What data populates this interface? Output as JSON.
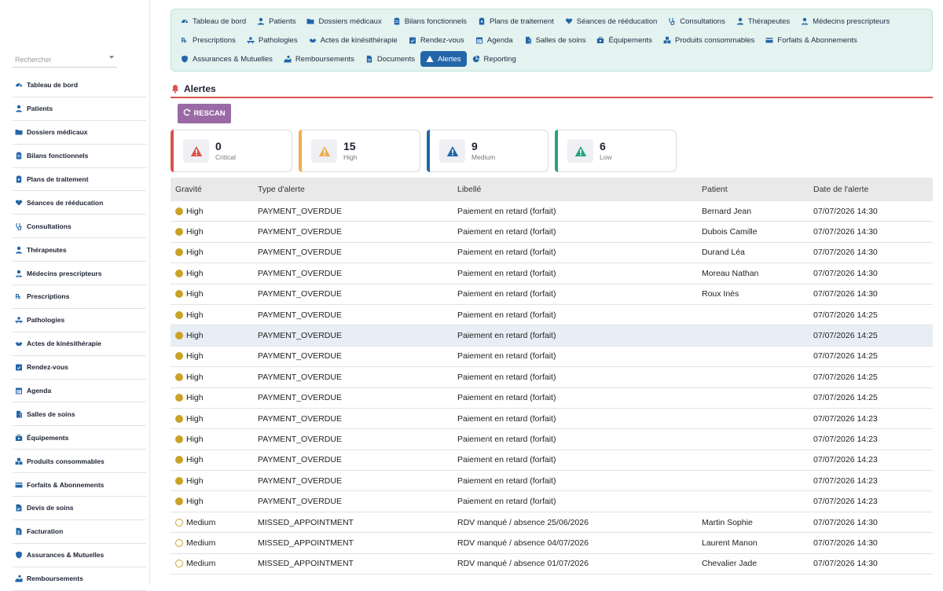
{
  "sidebar": {
    "search_placeholder": "Rechercher",
    "items": [
      {
        "label": "Tableau de bord",
        "icon": "dashboard-icon"
      },
      {
        "label": "Patients",
        "icon": "user-icon"
      },
      {
        "label": "Dossiers médicaux",
        "icon": "folder-icon"
      },
      {
        "label": "Bilans fonctionnels",
        "icon": "clipboard-icon"
      },
      {
        "label": "Plans de traitement",
        "icon": "clipboard-list-icon"
      },
      {
        "label": "Séances de rééducation",
        "icon": "heart-hand-icon"
      },
      {
        "label": "Consultations",
        "icon": "stethoscope-icon"
      },
      {
        "label": "Thérapeutes",
        "icon": "user-md-icon"
      },
      {
        "label": "Médecins prescripteurs",
        "icon": "doctor-icon"
      },
      {
        "label": "Prescriptions",
        "icon": "prescription-icon"
      },
      {
        "label": "Pathologies",
        "icon": "procedure-icon"
      },
      {
        "label": "Actes de kinésithérapie",
        "icon": "hands-icon"
      },
      {
        "label": "Rendez-vous",
        "icon": "calendar-check-icon"
      },
      {
        "label": "Agenda",
        "icon": "calendar-icon"
      },
      {
        "label": "Salles de soins",
        "icon": "door-icon"
      },
      {
        "label": "Équipements",
        "icon": "toolbox-icon"
      },
      {
        "label": "Produits consommables",
        "icon": "boxes-icon"
      },
      {
        "label": "Forfaits & Abonnements",
        "icon": "card-icon"
      },
      {
        "label": "Devis de soins",
        "icon": "file-edit-icon"
      },
      {
        "label": "Facturation",
        "icon": "invoice-icon"
      },
      {
        "label": "Assurances & Mutuelles",
        "icon": "shield-icon"
      },
      {
        "label": "Remboursements",
        "icon": "refund-icon"
      }
    ]
  },
  "topnav": {
    "row1": [
      {
        "label": "Tableau de bord",
        "icon": "dashboard-icon"
      },
      {
        "label": "Patients",
        "icon": "user-icon"
      },
      {
        "label": "Dossiers médicaux",
        "icon": "folder-icon"
      },
      {
        "label": "Bilans fonctionnels",
        "icon": "clipboard-icon"
      },
      {
        "label": "Plans de traitement",
        "icon": "clipboard-list-icon"
      },
      {
        "label": "Séances de rééducation",
        "icon": "heart-hand-icon"
      },
      {
        "label": "Consultations",
        "icon": "stethoscope-icon"
      },
      {
        "label": "Thérapeutes",
        "icon": "user-md-icon"
      },
      {
        "label": "Médecins prescripteurs",
        "icon": "doctor-icon"
      }
    ],
    "row2": [
      {
        "label": "Prescriptions",
        "icon": "prescription-icon"
      },
      {
        "label": "Pathologies",
        "icon": "procedure-icon"
      },
      {
        "label": "Actes de kinésithérapie",
        "icon": "hands-icon"
      },
      {
        "label": "Rendez-vous",
        "icon": "calendar-check-icon"
      },
      {
        "label": "Agenda",
        "icon": "calendar-icon"
      },
      {
        "label": "Salles de soins",
        "icon": "door-icon"
      },
      {
        "label": "Équipements",
        "icon": "toolbox-icon"
      },
      {
        "label": "Produits consommables",
        "icon": "boxes-icon"
      },
      {
        "label": "Forfaits & Abonnements",
        "icon": "card-icon"
      }
    ],
    "row3": [
      {
        "label": "Assurances & Mutuelles",
        "icon": "shield-icon"
      },
      {
        "label": "Remboursements",
        "icon": "refund-icon"
      },
      {
        "label": "Documents",
        "icon": "document-icon"
      },
      {
        "label": "Alertes",
        "icon": "warning-icon",
        "active": true
      },
      {
        "label": "Reporting",
        "icon": "pie-chart-icon"
      }
    ]
  },
  "page": {
    "title": "Alertes",
    "rescan_label": "RESCAN"
  },
  "stats": [
    {
      "value": "0",
      "label": "Critical",
      "color": "#d9534f",
      "icon_color": "#d9534f"
    },
    {
      "value": "15",
      "label": "High",
      "color": "#f0ad4e",
      "icon_color": "#f0ad4e"
    },
    {
      "value": "9",
      "label": "Medium",
      "color": "#2266a8",
      "icon_color": "#2266a8"
    },
    {
      "value": "6",
      "label": "Low",
      "color": "#27a37a",
      "icon_color": "#27a37a"
    }
  ],
  "table": {
    "headers": [
      "Gravité",
      "Type d'alerte",
      "Libellé",
      "Patient",
      "Date de l'alerte"
    ],
    "rows": [
      {
        "severity": "High",
        "type": "PAYMENT_OVERDUE",
        "label": "Paiement en retard (forfait)",
        "patient": "Bernard Jean",
        "date": "07/07/2026 14:30"
      },
      {
        "severity": "High",
        "type": "PAYMENT_OVERDUE",
        "label": "Paiement en retard (forfait)",
        "patient": "Dubois Camille",
        "date": "07/07/2026 14:30"
      },
      {
        "severity": "High",
        "type": "PAYMENT_OVERDUE",
        "label": "Paiement en retard (forfait)",
        "patient": "Durand Léa",
        "date": "07/07/2026 14:30"
      },
      {
        "severity": "High",
        "type": "PAYMENT_OVERDUE",
        "label": "Paiement en retard (forfait)",
        "patient": "Moreau Nathan",
        "date": "07/07/2026 14:30"
      },
      {
        "severity": "High",
        "type": "PAYMENT_OVERDUE",
        "label": "Paiement en retard (forfait)",
        "patient": "Roux Inès",
        "date": "07/07/2026 14:30"
      },
      {
        "severity": "High",
        "type": "PAYMENT_OVERDUE",
        "label": "Paiement en retard (forfait)",
        "patient": "",
        "date": "07/07/2026 14:25"
      },
      {
        "severity": "High",
        "type": "PAYMENT_OVERDUE",
        "label": "Paiement en retard (forfait)",
        "patient": "",
        "date": "07/07/2026 14:25",
        "highlight": true
      },
      {
        "severity": "High",
        "type": "PAYMENT_OVERDUE",
        "label": "Paiement en retard (forfait)",
        "patient": "",
        "date": "07/07/2026 14:25"
      },
      {
        "severity": "High",
        "type": "PAYMENT_OVERDUE",
        "label": "Paiement en retard (forfait)",
        "patient": "",
        "date": "07/07/2026 14:25"
      },
      {
        "severity": "High",
        "type": "PAYMENT_OVERDUE",
        "label": "Paiement en retard (forfait)",
        "patient": "",
        "date": "07/07/2026 14:25"
      },
      {
        "severity": "High",
        "type": "PAYMENT_OVERDUE",
        "label": "Paiement en retard (forfait)",
        "patient": "",
        "date": "07/07/2026 14:23"
      },
      {
        "severity": "High",
        "type": "PAYMENT_OVERDUE",
        "label": "Paiement en retard (forfait)",
        "patient": "",
        "date": "07/07/2026 14:23"
      },
      {
        "severity": "High",
        "type": "PAYMENT_OVERDUE",
        "label": "Paiement en retard (forfait)",
        "patient": "",
        "date": "07/07/2026 14:23"
      },
      {
        "severity": "High",
        "type": "PAYMENT_OVERDUE",
        "label": "Paiement en retard (forfait)",
        "patient": "",
        "date": "07/07/2026 14:23"
      },
      {
        "severity": "High",
        "type": "PAYMENT_OVERDUE",
        "label": "Paiement en retard (forfait)",
        "patient": "",
        "date": "07/07/2026 14:23"
      },
      {
        "severity": "Medium",
        "type": "MISSED_APPOINTMENT",
        "label": "RDV manqué / absence 25/06/2026",
        "patient": "Martin Sophie",
        "date": "07/07/2026 14:30"
      },
      {
        "severity": "Medium",
        "type": "MISSED_APPOINTMENT",
        "label": "RDV manqué / absence 04/07/2026",
        "patient": "Laurent Manon",
        "date": "07/07/2026 14:30"
      },
      {
        "severity": "Medium",
        "type": "MISSED_APPOINTMENT",
        "label": "RDV manqué / absence 01/07/2026",
        "patient": "Chevalier Jade",
        "date": "07/07/2026 14:30"
      }
    ]
  }
}
